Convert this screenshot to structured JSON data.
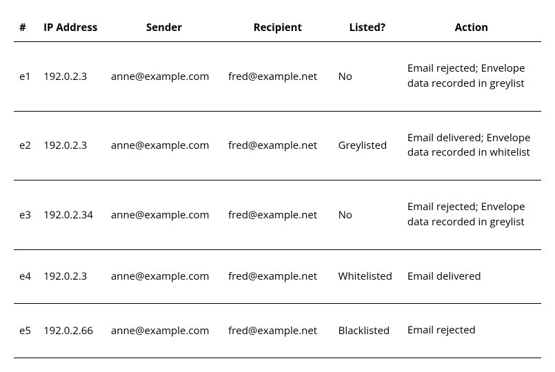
{
  "table": {
    "headers": {
      "num": "#",
      "ip": "IP Address",
      "sender": "Sender",
      "recipient": "Recipient",
      "listed": "Listed?",
      "action": "Action"
    },
    "rows": [
      {
        "num": "e1",
        "ip": "192.0.2.3",
        "sender": "anne@example.com",
        "recipient": "fred@example.net",
        "listed": "No",
        "action": "Email rejected; Envelope data recorded in greylist"
      },
      {
        "num": "e2",
        "ip": "192.0.2.3",
        "sender": "anne@example.com",
        "recipient": "fred@example.net",
        "listed": "Greylisted",
        "action": "Email delivered; Envelope data recorded in whitelist"
      },
      {
        "num": "e3",
        "ip": "192.0.2.34",
        "sender": "anne@example.com",
        "recipient": "fred@example.net",
        "listed": "No",
        "action": "Email rejected; Envelope data recorded in greylist"
      },
      {
        "num": "e4",
        "ip": "192.0.2.3",
        "sender": "anne@example.com",
        "recipient": "fred@example.net",
        "listed": "Whitelisted",
        "action": "Email delivered"
      },
      {
        "num": "e5",
        "ip": "192.0.2.66",
        "sender": "anne@example.com",
        "recipient": "fred@example.net",
        "listed": "Blacklisted",
        "action": "Email rejected"
      }
    ]
  }
}
